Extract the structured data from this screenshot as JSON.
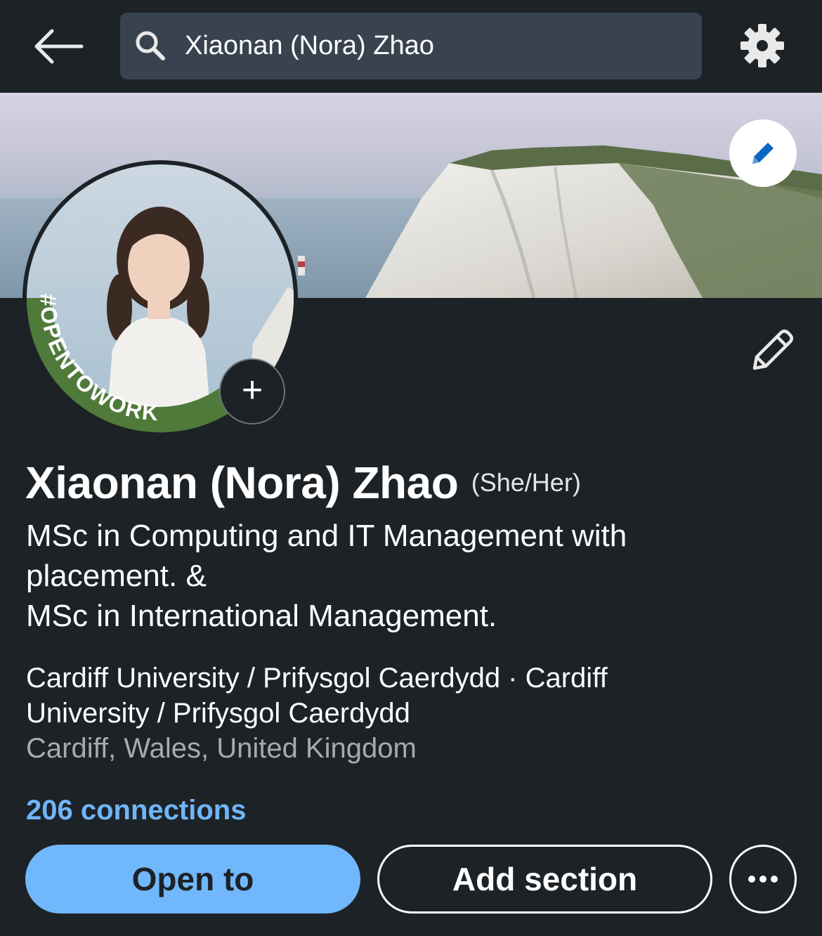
{
  "header": {
    "search_query": "Xiaonan (Nora) Zhao"
  },
  "icons": {
    "back": "arrow-left-icon",
    "search": "search-icon",
    "settings": "gear-icon",
    "banner_edit": "pencil-icon",
    "intro_edit": "pencil-icon",
    "avatar_add": "plus-icon",
    "more": "ellipsis-icon"
  },
  "profile": {
    "frame_label": "#OPENTOWORK",
    "name": "Xiaonan (Nora) Zhao",
    "pronouns": "(She/Her)",
    "headline": [
      "MSc in Computing and IT Management with",
      "placement. &",
      "MSc in International Management."
    ],
    "education": [
      "Cardiff University / Prifysgol Caerdydd · Cardiff",
      "University / Prifysgol Caerdydd"
    ],
    "location": "Cardiff, Wales, United Kingdom",
    "connections": "206 connections"
  },
  "actions": {
    "open_to": "Open to",
    "add_section": "Add section"
  },
  "colors": {
    "background": "#1d2226",
    "search_bg": "#38434f",
    "link_blue": "#70b5f9",
    "primary_button": "#71b7fb",
    "opentowork_green": "#4f7a3a"
  }
}
